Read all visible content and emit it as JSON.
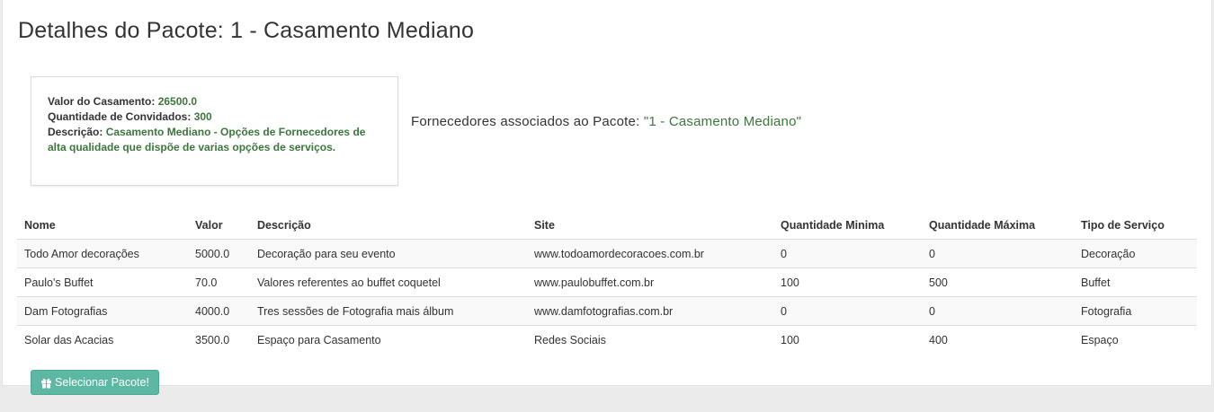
{
  "page": {
    "title": "Detalhes do Pacote: 1 - Casamento Mediano"
  },
  "package_info": {
    "value_label": "Valor do Casamento: ",
    "value": "26500.0",
    "guests_label": "Quantidade de Convidados: ",
    "guests": "300",
    "description_label": "Descrição: ",
    "description": "Casamento Mediano - Opções de Fornecedores de alta qualidade que dispõe de varias opções de serviços."
  },
  "suppliers_heading": {
    "label": "Fornecedores associados ao Pacote: ",
    "package": "\"1 - Casamento Mediano\""
  },
  "table": {
    "columns": [
      "Nome",
      "Valor",
      "Descrição",
      "Site",
      "Quantidade Minima",
      "Quantidade Máxima",
      "Tipo de Serviço"
    ],
    "rows": [
      [
        "Todo Amor decorações",
        "5000.0",
        "Decoração para seu evento",
        "www.todoamordecoracoes.com.br",
        "0",
        "0",
        "Decoração"
      ],
      [
        "Paulo's Buffet",
        "70.0",
        "Valores referentes ao buffet coquetel",
        "www.paulobuffet.com.br",
        "100",
        "500",
        "Buffet"
      ],
      [
        "Dam Fotografias",
        "4000.0",
        "Tres sessões de Fotografia mais álbum",
        "www.damfotografias.com.br",
        "0",
        "0",
        "Fotografia"
      ],
      [
        "Solar das Acacias",
        "3500.0",
        "Espaço para Casamento",
        "Redes Sociais",
        "100",
        "400",
        "Espaço"
      ]
    ]
  },
  "actions": {
    "select_label": "Selecionar Pacote!",
    "select_icon": "gift-icon"
  },
  "colors": {
    "accent_green": "#3c763d",
    "button": "#5cb8a3"
  }
}
